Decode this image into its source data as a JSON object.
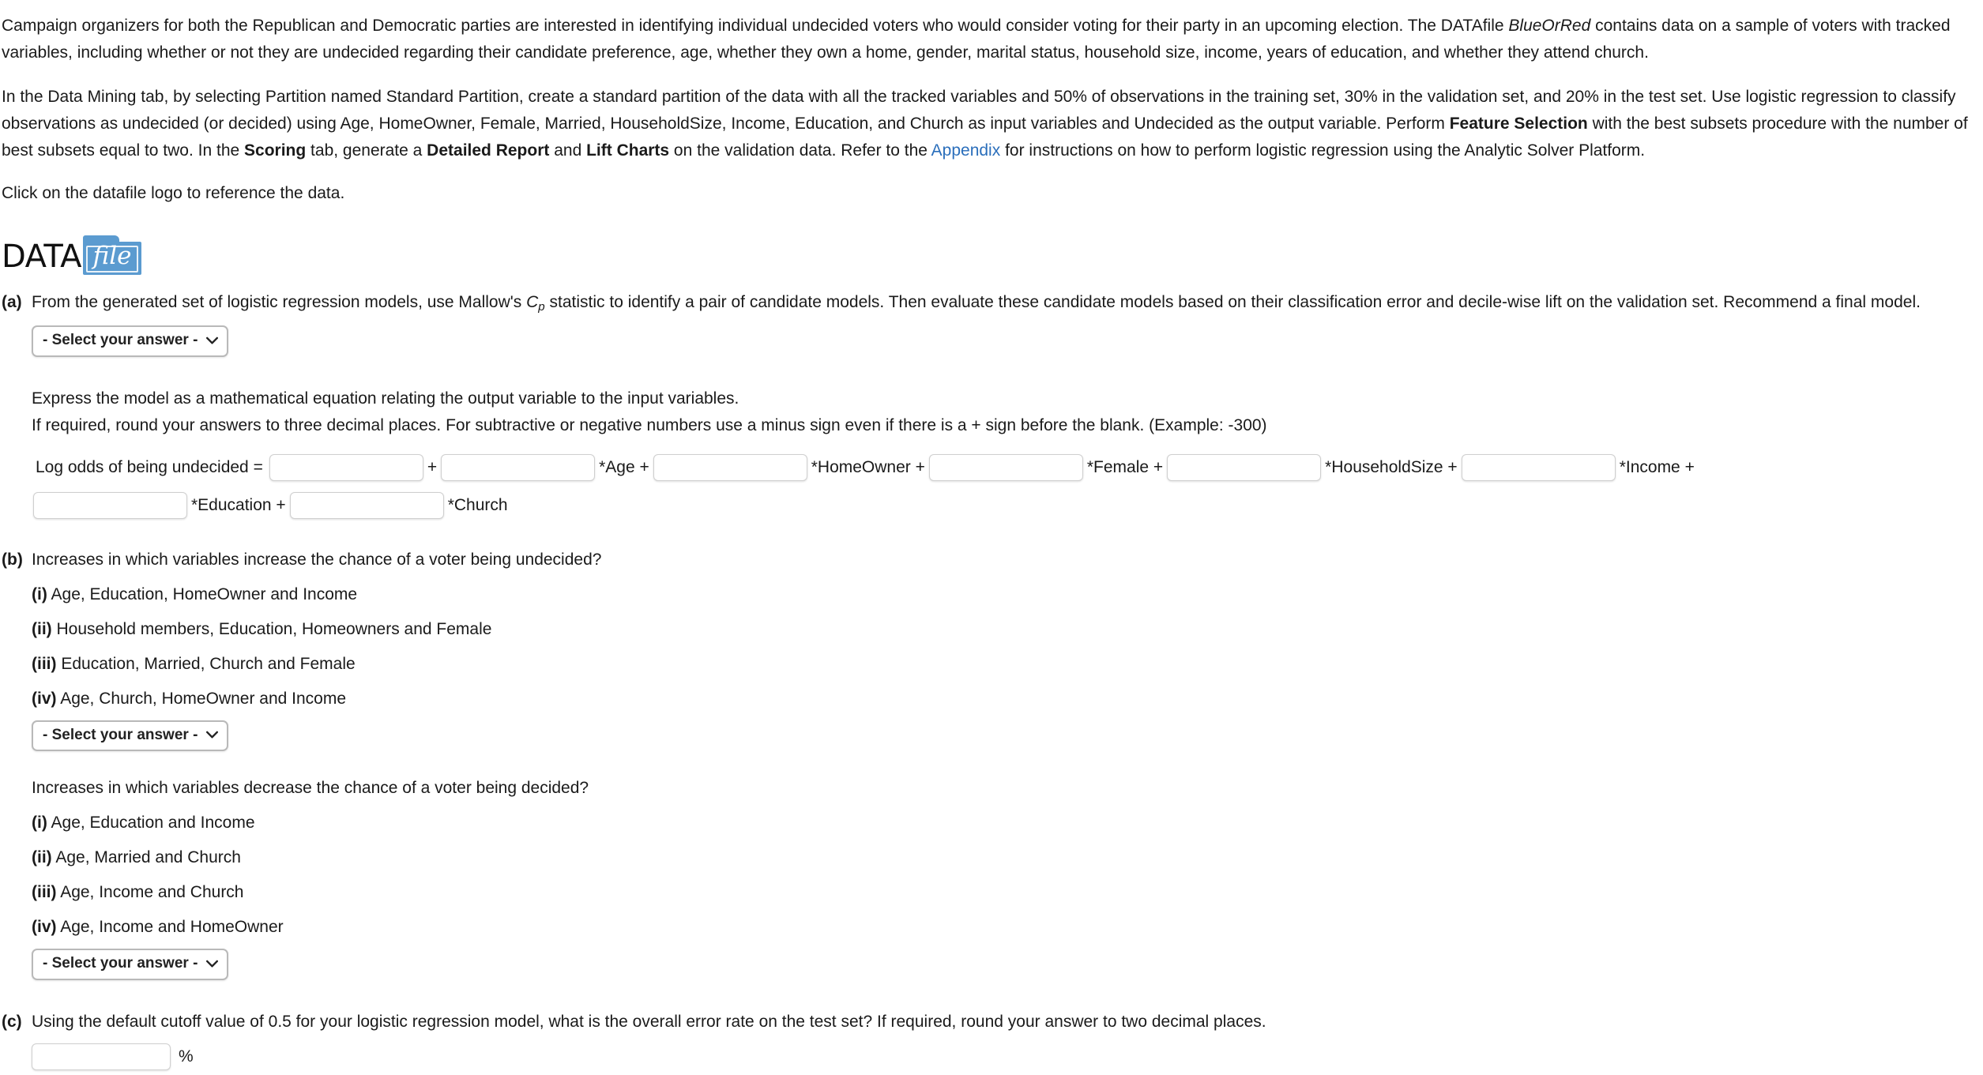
{
  "intro": {
    "p1_a": "Campaign organizers for both the Republican and Democratic parties are interested in identifying individual undecided voters who would consider voting for their party in an upcoming election. The DATAfile ",
    "p1_em": "BlueOrRed",
    "p1_b": " contains data on a sample of voters with tracked variables, including whether or not they are undecided regarding their candidate preference, age, whether they own a home, gender, marital status, household size, income, years of education, and whether they attend church.",
    "p2_a": "In the Data Mining tab, by selecting Partition named Standard Partition, create a standard partition of the data with all the tracked variables and 50% of observations in the training set, 30% in the validation set, and 20% in the test set. Use logistic regression to classify observations as undecided (or decided) using Age, HomeOwner, Female, Married, HouseholdSize, Income, Education, and Church as input variables and Undecided as the output variable. Perform ",
    "p2_b1": "Feature Selection",
    "p2_c": " with the best subsets procedure with the number of best subsets equal to two. In the ",
    "p2_b2": "Scoring",
    "p2_d": " tab, generate a ",
    "p2_b3": "Detailed Report",
    "p2_e": " and ",
    "p2_b4": "Lift Charts",
    "p2_f": " on the validation data. Refer to the ",
    "p2_link": "Appendix",
    "p2_g": " for instructions on how to perform logistic regression using the Analytic Solver Platform.",
    "p3": "Click on the datafile logo to reference the data."
  },
  "datafile": {
    "word": "DATA",
    "file": "file",
    "accent_color": "#5b9bd0"
  },
  "part_a": {
    "label": "(a)",
    "text_before_cp": "From the generated set of logistic regression models, use Mallow's ",
    "cp_main": "C",
    "cp_sub": "p",
    "text_after_cp": " statistic to identify a pair of candidate models. Then evaluate these candidate models based on their classification error and decile-wise lift on the validation set. Recommend a final model.",
    "select_value": "- Select your answer -",
    "chevron": "⌄",
    "express_text": "Express the model as a mathematical equation relating the output variable to the input variables.",
    "rounding_text": "If required, round your answers to three decimal places. For subtractive or negative numbers use a minus sign even if there is a + sign before the blank. (Example: -300)",
    "equation": {
      "lead": "Log odds of being undecided =",
      "blank_intercept": "",
      "plus": "+",
      "terms": [
        {
          "value": "",
          "label": "*Age +"
        },
        {
          "value": "",
          "label": "*HomeOwner +"
        },
        {
          "value": "",
          "label": "*Female +"
        },
        {
          "value": "",
          "label": "*HouseholdSize +"
        },
        {
          "value": "",
          "label": "*Income +"
        },
        {
          "value": "",
          "label": "*Education +"
        },
        {
          "value": "",
          "label": "*Church"
        }
      ]
    }
  },
  "part_b": {
    "label": "(b)",
    "q1_text": "Increases in which variables increase the chance of a voter being undecided?",
    "q1_options": [
      {
        "rn": "(i)",
        "text": "Age, Education, HomeOwner and Income"
      },
      {
        "rn": "(ii)",
        "text": "Household members, Education, Homeowners and Female"
      },
      {
        "rn": "(iii)",
        "text": "Education, Married, Church and Female"
      },
      {
        "rn": "(iv)",
        "text": "Age, Church, HomeOwner and Income"
      }
    ],
    "q1_select_value": "- Select your answer -",
    "q2_text": "Increases in which variables decrease the chance of a voter being decided?",
    "q2_options": [
      {
        "rn": "(i)",
        "text": "Age, Education and Income"
      },
      {
        "rn": "(ii)",
        "text": "Age, Married and Church"
      },
      {
        "rn": "(iii)",
        "text": "Age, Income and Church"
      },
      {
        "rn": "(iv)",
        "text": "Age, Income and HomeOwner"
      }
    ],
    "q2_select_value": "- Select your answer -"
  },
  "part_c": {
    "label": "(c)",
    "text": "Using the default cutoff value of 0.5 for your logistic regression model, what is the overall error rate on the test set? If required, round your answer to two decimal places.",
    "answer_value": "",
    "unit": "%"
  },
  "select_options": [
    "- Select your answer -"
  ]
}
